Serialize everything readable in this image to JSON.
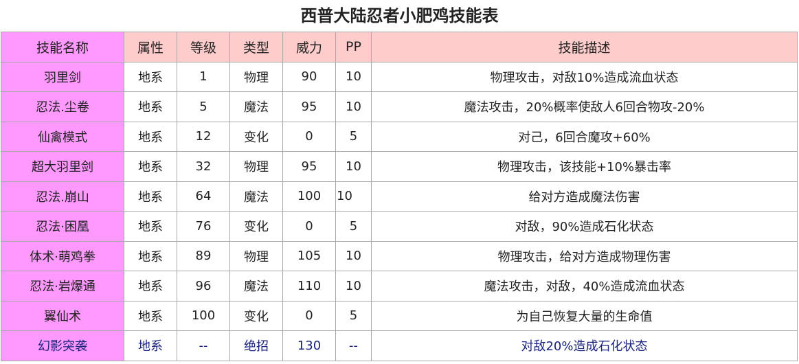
{
  "title": "西普大陆忍者小肥鸡技能表",
  "columns": [
    "技能名称",
    "属性",
    "等级",
    "类型",
    "威力",
    "PP",
    "技能描述"
  ],
  "rows": [
    [
      "羽里剑",
      "地系",
      "1",
      "物理",
      "90",
      "10",
      "物理攻击，对敌10%造成流血状态"
    ],
    [
      "忍法.尘卷",
      "地系",
      "5",
      "魔法",
      "95",
      "10",
      "魔法攻击，20%概率使敌人6回合物攻-20%"
    ],
    [
      "仙禽模式",
      "地系",
      "12",
      "变化",
      "0",
      "5",
      "对己，6回合魔攻+60%"
    ],
    [
      "超大羽里剑",
      "地系",
      "32",
      "物理",
      "95",
      "10",
      "物理攻击，该技能+10%暴击率"
    ],
    [
      "忍法.崩山",
      "地系",
      "64",
      "魔法",
      "100",
      "10",
      "给对方造成魔法伤害"
    ],
    [
      "忍法·困凰",
      "地系",
      "76",
      "变化",
      "0",
      "5",
      "对敌，90%造成石化状态"
    ],
    [
      "体术·萌鸡拳",
      "地系",
      "89",
      "物理",
      "105",
      "10",
      "物理攻击，给对方造成物理伤害"
    ],
    [
      "忍法·岩爆通",
      "地系",
      "96",
      "魔法",
      "110",
      "10",
      "魔法攻击，对敌，40%造成流血状态"
    ],
    [
      "翼仙术",
      "地系",
      "100",
      "变化",
      "0",
      "5",
      "为自己恢复大量的生命值"
    ],
    [
      "幻影突袭",
      "地系",
      "--",
      "绝招",
      "130",
      "--",
      "对敌20%造成石化状态"
    ]
  ]
}
